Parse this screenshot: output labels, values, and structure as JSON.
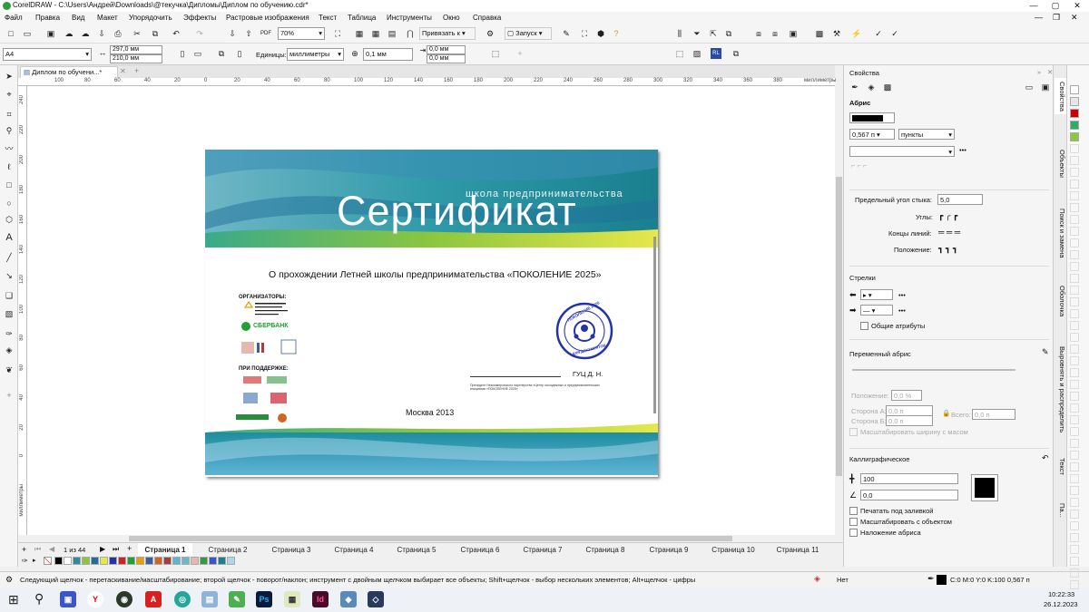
{
  "window": {
    "title": "CorelDRAW - C:\\Users\\Андрей\\Downloads\\@текучка\\Дипломы\\Диплом по обучению.cdr*"
  },
  "menu": [
    "Файл",
    "Правка",
    "Вид",
    "Макет",
    "Упорядочить",
    "Эффекты",
    "Растровые изображения",
    "Текст",
    "Таблица",
    "Инструменты",
    "Окно",
    "Справка"
  ],
  "toolbar1": {
    "zoom": "70%",
    "snap": "Привязать к",
    "launch": "Запуск"
  },
  "toolbar2": {
    "page_size": "A4",
    "width": "297,0 мм",
    "height": "210,0 мм",
    "units_label": "Единицы:",
    "units": "миллиметры",
    "nudge": "0,1 мм",
    "dup_x": "0,0 мм",
    "dup_y": "0,0 мм"
  },
  "doc_tab": "Диплом по обучени...*",
  "hruler": [
    "100",
    "80",
    "60",
    "40",
    "20",
    "0",
    "20",
    "40",
    "60",
    "80",
    "100",
    "120",
    "140",
    "160",
    "180",
    "200",
    "220",
    "240",
    "260",
    "280",
    "300",
    "320",
    "340",
    "360",
    "380",
    "миллиметры"
  ],
  "vruler": [
    "240",
    "220",
    "200",
    "180",
    "160",
    "140",
    "120",
    "100",
    "80",
    "60",
    "40",
    "20",
    "0",
    "миллиметры"
  ],
  "certificate": {
    "subtitle": "школа предпринимательства",
    "title": "Сертификат",
    "text": "О прохождении Летней школы предпринимательства «ПОКОЛЕНИЕ 2025»",
    "organizers": "ОРГАНИЗАТОРЫ:",
    "sberbank": "СБЕРБАНК",
    "support": "ПРИ ПОДДЕРЖКЕ:",
    "signer": "ГУЦ Д. Н.",
    "sign_caption": "Президент Некоммерческого партнерства «Центр молодежных и предпринимательских инициатив «ПОКОЛЕНИЕ 2025»",
    "city_year": "Москва 2013",
    "stamp_text": "ПОКОЛЕНИЕ 2025",
    "stamp_bottom": "ДЛЯ ДОКУМЕНТОВ"
  },
  "pages": {
    "counter": "1 из 44",
    "tabs": [
      "Страница 1",
      "Страница 2",
      "Страница 3",
      "Страница 4",
      "Страница 5",
      "Страница 6",
      "Страница 7",
      "Страница 8",
      "Страница 9",
      "Страница 10",
      "Страница 11"
    ]
  },
  "status": {
    "hint": "Следующий щелчок - перетаскивание/масштабирование; второй щелчок - поворот/наклон; инструмент с двойным щелчком выбирает все объекты; Shift+щелчок - выбор нескольких элементов; Alt+щелчок - цифры",
    "fill": "Нет",
    "outline": "C:0 M:0 Y:0 K:100  0,567 п"
  },
  "props": {
    "header": "Свойства",
    "outline_label": "Абрис",
    "width_value": "0,567 п",
    "width_unit": "пункты",
    "miter_label": "Предельный угол стыка:",
    "miter_value": "5,0",
    "corners_label": "Углы:",
    "ends_label": "Концы линий:",
    "position_label": "Положение:",
    "arrows_label": "Стрелки",
    "common_attrs": "Общие атрибуты",
    "variable_label": "Переменный абрис",
    "var_position_label": "Положение:",
    "var_position_value": "0,0 %",
    "side_a_label": "Сторона А:",
    "side_a_value": "0,0 п",
    "side_b_label": "Сторона Б:",
    "side_b_value": "0,0 п",
    "all_label": "Всего:",
    "all_value": "0,0 п",
    "scale_var": "Масштабировать ширину с масом",
    "calligraphic_label": "Каллиграфическое",
    "stretch_value": "100",
    "angle_value": "0,0",
    "behind_fill": "Печатать под заливкой",
    "scale_with_object": "Масштабировать с объектом",
    "overprint": "Наложение абриса"
  },
  "docktabs": [
    "Свойства",
    "Объекты",
    "Поиск и замена",
    "Оболочка",
    "Выровнять и распределить",
    "Текст",
    "Па..."
  ],
  "taskbar": {
    "time": "10:22:33",
    "date": "26.12.2023"
  },
  "colors": {
    "teal": "#2a8f9b",
    "green": "#8cc63f",
    "stamp": "#2233aa"
  }
}
